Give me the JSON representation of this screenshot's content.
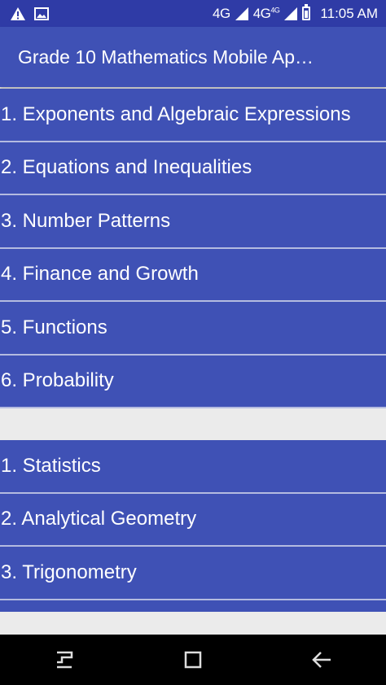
{
  "status_bar": {
    "network_1": "4G",
    "network_2": "4G",
    "network_2_sup": "4G",
    "time": "11:05 AM"
  },
  "app_bar": {
    "title": "Grade 10 Mathematics Mobile Ap…"
  },
  "group_1": [
    {
      "label": "1. Exponents and Algebraic Expressions"
    },
    {
      "label": "2. Equations and Inequalities"
    },
    {
      "label": "3. Number Patterns"
    },
    {
      "label": "4. Finance and Growth"
    },
    {
      "label": "5. Functions"
    },
    {
      "label": "6. Probability"
    }
  ],
  "group_2": [
    {
      "label": "1. Statistics"
    },
    {
      "label": "2. Analytical Geometry"
    },
    {
      "label": "3. Trigonometry"
    }
  ],
  "colors": {
    "app_bar": "#3f51b5",
    "status_bar": "#2f3ba6",
    "divider": "#b4bbe0",
    "background": "#ebebeb"
  }
}
